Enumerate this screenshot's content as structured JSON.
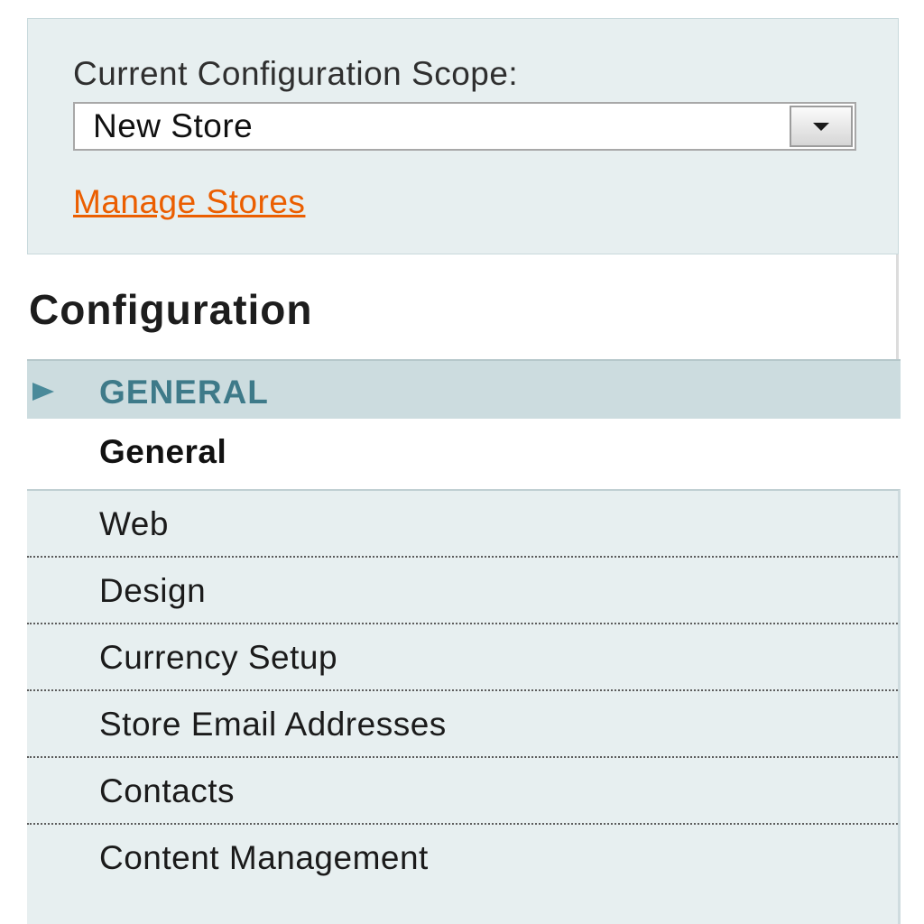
{
  "scope": {
    "label": "Current Configuration Scope:",
    "selected_value": "New Store",
    "manage_link": "Manage Stores"
  },
  "config": {
    "title": "Configuration"
  },
  "section": {
    "label": "GENERAL",
    "icon": "triangle-right-icon",
    "accent_color": "#3e7a89",
    "active_item": "General",
    "items": [
      {
        "label": "Web"
      },
      {
        "label": "Design"
      },
      {
        "label": "Currency Setup"
      },
      {
        "label": "Store Email Addresses"
      },
      {
        "label": "Contacts"
      },
      {
        "label": "Content Management"
      }
    ]
  },
  "colors": {
    "link": "#eb5e00",
    "panel_bg": "#e7eff0",
    "section_bg": "#ccdcdf"
  }
}
